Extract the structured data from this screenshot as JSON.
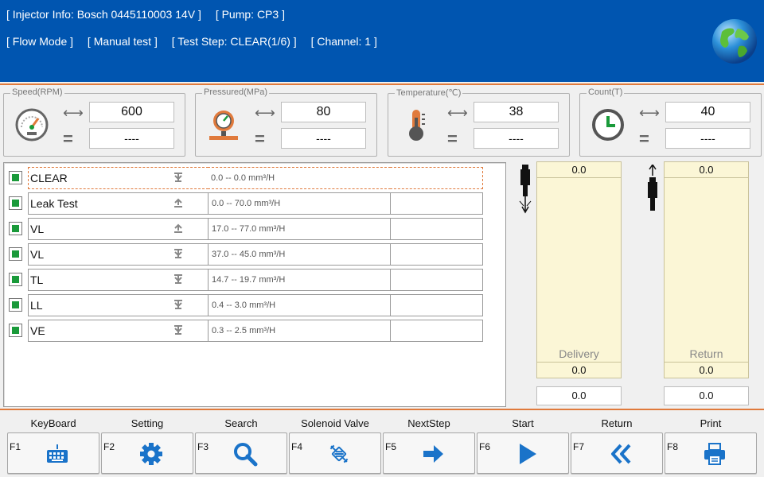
{
  "header": {
    "line1": [
      "[ Injector Info: Bosch  0445110003  14V ]",
      "[ Pump: CP3 ]"
    ],
    "line2": [
      "[ Flow Mode ]",
      "[ Manual test ]",
      "[ Test Step: CLEAR(1/6) ]",
      "[ Channel: 1 ]"
    ],
    "globe_icon": "globe-icon"
  },
  "gauges": [
    {
      "label": "Speed(RPM)",
      "set": "600",
      "actual": "----",
      "icon": "speedometer-icon"
    },
    {
      "label": "Pressured(MPa)",
      "set": "80",
      "actual": "----",
      "icon": "pressure-gauge-icon"
    },
    {
      "label": "Temperature(℃)",
      "set": "38",
      "actual": "----",
      "icon": "thermometer-icon"
    },
    {
      "label": "Count(T)",
      "set": "40",
      "actual": "----",
      "icon": "clock-icon"
    }
  ],
  "steps": [
    {
      "name": "CLEAR",
      "range": "0.0 -- 0.0 mm³/H",
      "result": "",
      "direction": "down"
    },
    {
      "name": "Leak Test",
      "range": "0.0 -- 70.0 mm³/H",
      "result": "",
      "direction": "up"
    },
    {
      "name": "VL",
      "range": "17.0 -- 77.0 mm³/H",
      "result": "",
      "direction": "up"
    },
    {
      "name": "VL",
      "range": "37.0 -- 45.0 mm³/H",
      "result": "",
      "direction": "down"
    },
    {
      "name": "TL",
      "range": "14.7 -- 19.7 mm³/H",
      "result": "",
      "direction": "down"
    },
    {
      "name": "LL",
      "range": "0.4 -- 3.0 mm³/H",
      "result": "",
      "direction": "down"
    },
    {
      "name": "VE",
      "range": "0.3 -- 2.5 mm³/H",
      "result": "",
      "direction": "down"
    }
  ],
  "delivery": {
    "top": "0.0",
    "label": "Delivery",
    "bottom": "0.0",
    "value": "0.0"
  },
  "return": {
    "top": "0.0",
    "label": "Return",
    "bottom": "0.0",
    "value": "0.0"
  },
  "fkeys": [
    {
      "key": "F1",
      "title": "KeyBoard",
      "icon": "keyboard-icon"
    },
    {
      "key": "F2",
      "title": "Setting",
      "icon": "gear-icon"
    },
    {
      "key": "F3",
      "title": "Search",
      "icon": "search-icon"
    },
    {
      "key": "F4",
      "title": "Solenoid Valve",
      "icon": "solenoid-valve-icon"
    },
    {
      "key": "F5",
      "title": "NextStep",
      "icon": "arrow-right-icon"
    },
    {
      "key": "F6",
      "title": "Start",
      "icon": "play-icon"
    },
    {
      "key": "F7",
      "title": "Return",
      "icon": "double-chevron-left-icon"
    },
    {
      "key": "F8",
      "title": "Print",
      "icon": "printer-icon"
    }
  ],
  "colors": {
    "header_bg": "#0055b0",
    "accent": "#e07a3c",
    "icon_blue": "#1a73c9",
    "check_green": "#1a9a3a"
  }
}
